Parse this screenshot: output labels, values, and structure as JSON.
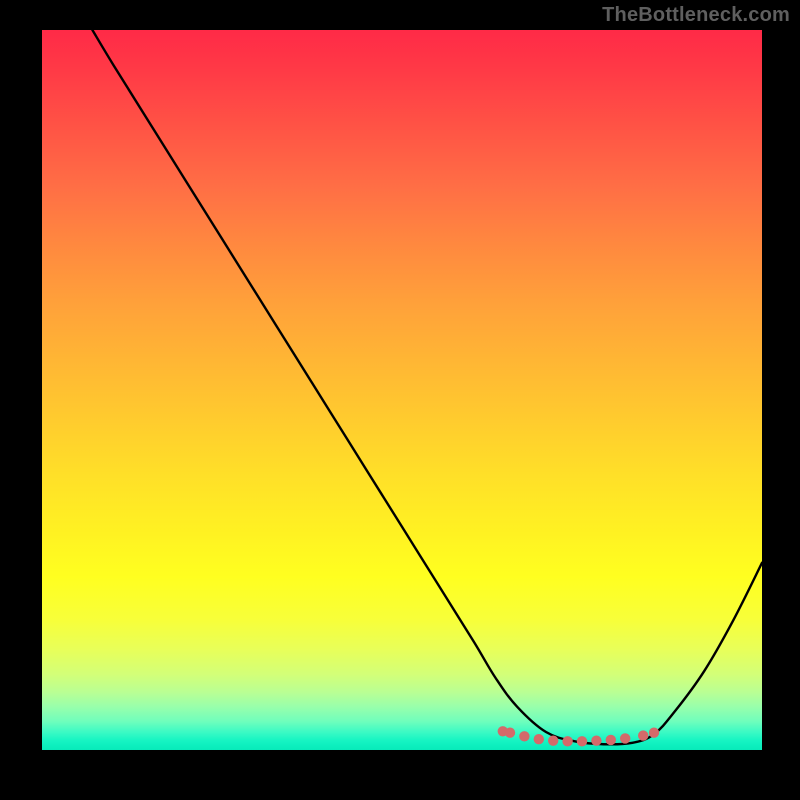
{
  "watermark": "TheBottleneck.com",
  "chart_data": {
    "type": "line",
    "title": "",
    "xlabel": "",
    "ylabel": "",
    "xlim": [
      0,
      100
    ],
    "ylim": [
      0,
      100
    ],
    "grid": false,
    "legend": false,
    "series": [
      {
        "name": "bottleneck-curve",
        "x": [
          7,
          10,
          15,
          20,
          25,
          30,
          35,
          40,
          45,
          50,
          55,
          60,
          63,
          66,
          70,
          74,
          78,
          82,
          85,
          88,
          92,
          96,
          100
        ],
        "y": [
          100,
          95,
          87,
          79,
          71,
          63,
          55,
          47,
          39,
          31,
          23,
          15,
          10,
          6,
          2.5,
          1.2,
          0.8,
          1.0,
          2.2,
          5.5,
          11,
          18,
          26
        ]
      }
    ],
    "markers": {
      "name": "trough-markers",
      "color": "#d46a6a",
      "points": [
        {
          "x": 64,
          "y": 2.6
        },
        {
          "x": 65,
          "y": 2.4
        },
        {
          "x": 67,
          "y": 1.9
        },
        {
          "x": 69,
          "y": 1.5
        },
        {
          "x": 71,
          "y": 1.3
        },
        {
          "x": 73,
          "y": 1.2
        },
        {
          "x": 75,
          "y": 1.2
        },
        {
          "x": 77,
          "y": 1.3
        },
        {
          "x": 79,
          "y": 1.4
        },
        {
          "x": 81,
          "y": 1.6
        },
        {
          "x": 83.5,
          "y": 2.0
        },
        {
          "x": 85,
          "y": 2.4
        }
      ]
    },
    "gradient_stops": [
      {
        "pos": 0,
        "color": "#ff2a47"
      },
      {
        "pos": 0.5,
        "color": "#ffc631"
      },
      {
        "pos": 0.78,
        "color": "#fffb22"
      },
      {
        "pos": 1.0,
        "color": "#08eaba"
      }
    ]
  }
}
